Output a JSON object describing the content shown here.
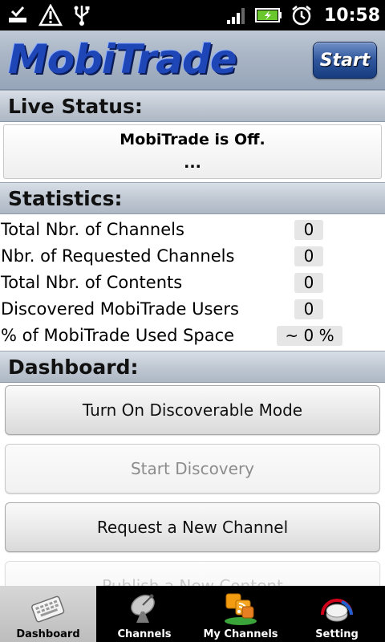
{
  "status_bar": {
    "time": "10:58",
    "icons": [
      "download-done-icon",
      "warning-icon",
      "usb-icon",
      "signal-icon",
      "battery-charging-icon",
      "alarm-clock-icon"
    ]
  },
  "header": {
    "logo_text": "MobiTrade",
    "start_button": "Start"
  },
  "live_status": {
    "title": "Live Status:",
    "message": "MobiTrade is Off.",
    "detail": "..."
  },
  "statistics": {
    "title": "Statistics:",
    "rows": [
      {
        "label": "Total Nbr. of Channels",
        "value": "0"
      },
      {
        "label": "Nbr. of Requested Channels",
        "value": "0"
      },
      {
        "label": "Total Nbr. of Contents",
        "value": "0"
      },
      {
        "label": "Discovered MobiTrade Users",
        "value": "0"
      },
      {
        "label": "% of MobiTrade Used Space",
        "value": "~ 0 %"
      }
    ]
  },
  "dashboard": {
    "title": "Dashboard:",
    "buttons": [
      {
        "label": "Turn On Discoverable Mode",
        "enabled": true
      },
      {
        "label": "Start Discovery",
        "enabled": false
      },
      {
        "label": "Request a New Channel",
        "enabled": true
      },
      {
        "label": "Publish a New Content",
        "enabled": true
      }
    ]
  },
  "tabs": [
    {
      "label": "Dashboard",
      "icon": "keyboard-icon",
      "active": true
    },
    {
      "label": "Channels",
      "icon": "satellite-dish-icon",
      "active": false
    },
    {
      "label": "My Channels",
      "icon": "rss-feeds-icon",
      "active": false
    },
    {
      "label": "Setting",
      "icon": "settings-knob-icon",
      "active": false
    }
  ],
  "colors": {
    "logo_blue": "#1f46b6",
    "header_bg": "#aab6c6",
    "section_bg": "#bcc5d0",
    "statusbar_bg": "#000000"
  }
}
